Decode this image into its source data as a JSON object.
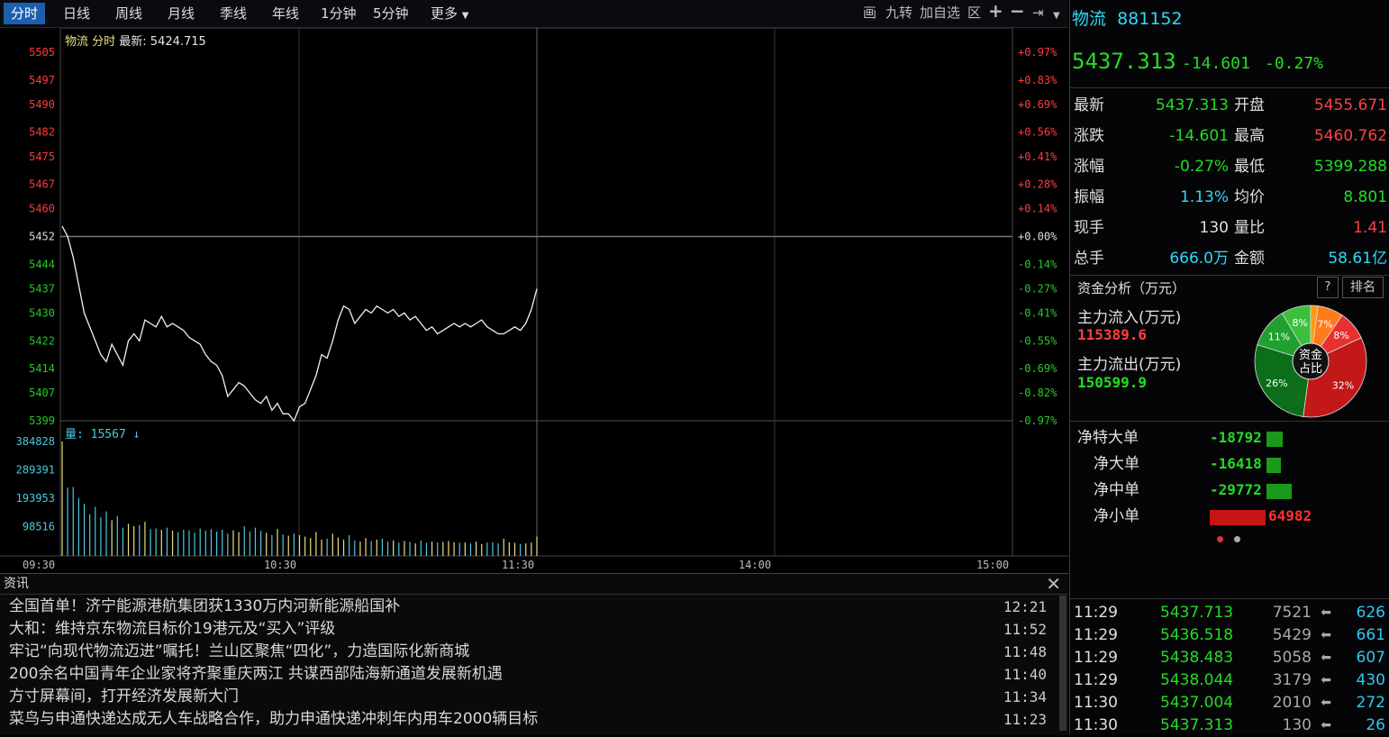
{
  "toolbar": {
    "periods": [
      "分时",
      "日线",
      "周线",
      "月线",
      "季线",
      "年线",
      "1分钟",
      "5分钟",
      "更多"
    ],
    "active_period": "分时",
    "tools": {
      "draw": "画",
      "nine": "九转",
      "add_fav": "加自选",
      "region": "区"
    }
  },
  "chart": {
    "title_name": "物流 分时",
    "title_latest": "最新: 5424.715",
    "prev_close": 5452,
    "price_ticks": [
      "5505",
      "5497",
      "5490",
      "5482",
      "5475",
      "5467",
      "5460",
      "5452",
      "5444",
      "5437",
      "5430",
      "5422",
      "5414",
      "5407",
      "5399"
    ],
    "pct_ticks": [
      "+0.97%",
      "+0.83%",
      "+0.69%",
      "+0.56%",
      "+0.41%",
      "+0.28%",
      "+0.14%",
      "+0.00%",
      "-0.14%",
      "-0.27%",
      "-0.41%",
      "-0.55%",
      "-0.69%",
      "-0.82%",
      "-0.97%"
    ],
    "volume_label": "量: 15567",
    "volume_ticks": [
      "384828",
      "289391",
      "193953",
      "98516"
    ],
    "time_ticks": [
      "09:30",
      "10:30",
      "11:30",
      "14:00",
      "15:00"
    ]
  },
  "chart_data": {
    "type": "line",
    "xlabel": "",
    "ylabel": "",
    "ylim": [
      5399,
      5505
    ],
    "x_range": [
      "09:30",
      "15:00"
    ],
    "series": [
      {
        "values": [
          5455,
          5452,
          5446,
          5438,
          5430,
          5426,
          5422,
          5418,
          5416,
          5421,
          5418,
          5415,
          5422,
          5424,
          5422,
          5428,
          5427,
          5426,
          5429,
          5426,
          5427,
          5426,
          5425,
          5423,
          5422,
          5421,
          5418,
          5416,
          5415,
          5412,
          5406,
          5408,
          5410,
          5409,
          5407,
          5405,
          5404,
          5406,
          5402,
          5404,
          5401,
          5401,
          5399,
          5403,
          5404,
          5408,
          5412,
          5418,
          5417,
          5422,
          5428,
          5432,
          5431,
          5427,
          5429,
          5431,
          5430,
          5432,
          5431,
          5430,
          5431,
          5429,
          5430,
          5428,
          5429,
          5427,
          5425,
          5426,
          5424,
          5425,
          5426,
          5427,
          5426,
          5427,
          5426,
          5427,
          5428,
          5426,
          5425,
          5424,
          5424,
          5425,
          5426,
          5425,
          5427,
          5431,
          5437
        ]
      }
    ],
    "volume": [
      384828,
      230000,
      232000,
      195000,
      175000,
      140000,
      165000,
      130000,
      150000,
      120000,
      135000,
      95000,
      108000,
      100000,
      104000,
      115000,
      90000,
      92000,
      88000,
      95000,
      85000,
      80000,
      88000,
      86000,
      78000,
      92000,
      85000,
      90000,
      82000,
      88000,
      75000,
      86000,
      80000,
      100000,
      82000,
      95000,
      84000,
      78000,
      70000,
      90000,
      72000,
      68000,
      75000,
      70000,
      65000,
      60000,
      80000,
      55000,
      58000,
      75000,
      62000,
      55000,
      70000,
      52000,
      48000,
      60000,
      50000,
      55000,
      58000,
      48000,
      52000,
      45000,
      50000,
      47000,
      42000,
      52000,
      44000,
      48000,
      45000,
      47000,
      50000,
      46000,
      44000,
      45000,
      42000,
      48000,
      40000,
      45000,
      46000,
      42000,
      58000,
      46000,
      44000,
      40000,
      42000,
      45000,
      65000
    ]
  },
  "news": {
    "header": "资讯",
    "items": [
      {
        "title": "全国首单！济宁能源港航集团获1330万内河新能源船国补",
        "time": "12:21"
      },
      {
        "title": "大和：维持京东物流目标价19港元及“买入”评级",
        "time": "11:52"
      },
      {
        "title": "牢记“向现代物流迈进”嘱托！兰山区聚焦“四化”，力造国际化新商城",
        "time": "11:48"
      },
      {
        "title": "200余名中国青年企业家将齐聚重庆两江 共谋西部陆海新通道发展新机遇",
        "time": "11:40"
      },
      {
        "title": "方寸屏幕间，打开经济发展新大门",
        "time": "11:34"
      },
      {
        "title": "菜鸟与申通快递达成无人车战略合作，助力申通快递冲刺年内用车2000辆目标",
        "time": "11:23"
      }
    ]
  },
  "quote": {
    "name": "物流",
    "code": "881152",
    "price": "5437.313",
    "change": "-14.601",
    "change_pct": "-0.27%",
    "rows": [
      {
        "l1": "最新",
        "v1": "5437.313",
        "l2": "开盘",
        "v2": "5455.671"
      },
      {
        "l1": "涨跌",
        "v1": "-14.601",
        "l2": "最高",
        "v2": "5460.762"
      },
      {
        "l1": "涨幅",
        "v1": "-0.27%",
        "l2": "最低",
        "v2": "5399.288"
      },
      {
        "l1": "振幅",
        "v1": "1.13%",
        "l2": "均价",
        "v2": "8.801"
      },
      {
        "l1": "现手",
        "v1": "130",
        "l2": "量比",
        "v2": "1.41"
      },
      {
        "l1": "总手",
        "v1": "666.0万",
        "l2": "金额",
        "v2": "58.61亿"
      }
    ]
  },
  "capital": {
    "title": "资金分析（万元）",
    "help": "?",
    "rank": "排名",
    "inflow_label": "主力流入(万元)",
    "inflow_value": "115389.6",
    "outflow_label": "主力流出(万元)",
    "outflow_value": "150599.9",
    "pie_center": [
      "资金",
      "占比"
    ],
    "pie": [
      {
        "label": "7%",
        "value": 7,
        "color": "#ff7a1a"
      },
      {
        "label": "8%",
        "value": 8,
        "color": "#e83030"
      },
      {
        "label": "32%",
        "value": 32,
        "color": "#c21818"
      },
      {
        "label": "26%",
        "value": 26,
        "color": "#0c6e1a"
      },
      {
        "label": "11%",
        "value": 11,
        "color": "#20a030"
      },
      {
        "label": "8%",
        "value": 8,
        "color": "#3cc03c"
      },
      {
        "label": "",
        "value": 2,
        "color": "#ff9a1a"
      }
    ],
    "flows": [
      {
        "label": "净特大单",
        "value": "-18792",
        "amount": -18792
      },
      {
        "label": "净大单",
        "value": "-16418",
        "amount": -16418
      },
      {
        "label": "净中单",
        "value": "-29772",
        "amount": -29772
      },
      {
        "label": "净小单",
        "value": "64982",
        "amount": 64982
      }
    ]
  },
  "trades": [
    {
      "time": "11:29",
      "price": "5437.713",
      "vol": "7521",
      "num": "626"
    },
    {
      "time": "11:29",
      "price": "5436.518",
      "vol": "5429",
      "num": "661"
    },
    {
      "time": "11:29",
      "price": "5438.483",
      "vol": "5058",
      "num": "607"
    },
    {
      "time": "11:29",
      "price": "5438.044",
      "vol": "3179",
      "num": "430"
    },
    {
      "time": "11:30",
      "price": "5437.004",
      "vol": "2010",
      "num": "272"
    },
    {
      "time": "11:30",
      "price": "5437.313",
      "vol": "130",
      "num": "26"
    }
  ]
}
